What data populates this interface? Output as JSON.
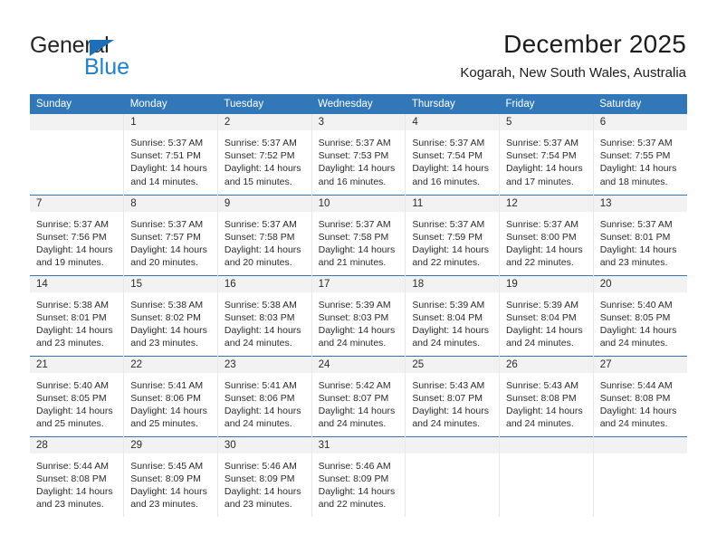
{
  "brand": {
    "word_one": "General",
    "word_two": "Blue",
    "triangle_color": "#1d6fb8",
    "blue_text_color": "#2081c9"
  },
  "header": {
    "title": "December 2025",
    "subtitle": "Kogarah, New South Wales, Australia",
    "header_bg_color": "#3278b8",
    "header_text_color": "#ffffff",
    "daynum_bg_color": "#f2f2f2"
  },
  "weekday_headers": [
    "Sunday",
    "Monday",
    "Tuesday",
    "Wednesday",
    "Thursday",
    "Friday",
    "Saturday"
  ],
  "weeks": [
    [
      {
        "day": "",
        "blank": true,
        "sunrise": "",
        "sunset": "",
        "daylight_1": "",
        "daylight_2": ""
      },
      {
        "day": "1",
        "sunrise": "Sunrise: 5:37 AM",
        "sunset": "Sunset: 7:51 PM",
        "daylight_1": "Daylight: 14 hours",
        "daylight_2": "and 14 minutes."
      },
      {
        "day": "2",
        "sunrise": "Sunrise: 5:37 AM",
        "sunset": "Sunset: 7:52 PM",
        "daylight_1": "Daylight: 14 hours",
        "daylight_2": "and 15 minutes."
      },
      {
        "day": "3",
        "sunrise": "Sunrise: 5:37 AM",
        "sunset": "Sunset: 7:53 PM",
        "daylight_1": "Daylight: 14 hours",
        "daylight_2": "and 16 minutes."
      },
      {
        "day": "4",
        "sunrise": "Sunrise: 5:37 AM",
        "sunset": "Sunset: 7:54 PM",
        "daylight_1": "Daylight: 14 hours",
        "daylight_2": "and 16 minutes."
      },
      {
        "day": "5",
        "sunrise": "Sunrise: 5:37 AM",
        "sunset": "Sunset: 7:54 PM",
        "daylight_1": "Daylight: 14 hours",
        "daylight_2": "and 17 minutes."
      },
      {
        "day": "6",
        "sunrise": "Sunrise: 5:37 AM",
        "sunset": "Sunset: 7:55 PM",
        "daylight_1": "Daylight: 14 hours",
        "daylight_2": "and 18 minutes."
      }
    ],
    [
      {
        "day": "7",
        "sunrise": "Sunrise: 5:37 AM",
        "sunset": "Sunset: 7:56 PM",
        "daylight_1": "Daylight: 14 hours",
        "daylight_2": "and 19 minutes."
      },
      {
        "day": "8",
        "sunrise": "Sunrise: 5:37 AM",
        "sunset": "Sunset: 7:57 PM",
        "daylight_1": "Daylight: 14 hours",
        "daylight_2": "and 20 minutes."
      },
      {
        "day": "9",
        "sunrise": "Sunrise: 5:37 AM",
        "sunset": "Sunset: 7:58 PM",
        "daylight_1": "Daylight: 14 hours",
        "daylight_2": "and 20 minutes."
      },
      {
        "day": "10",
        "sunrise": "Sunrise: 5:37 AM",
        "sunset": "Sunset: 7:58 PM",
        "daylight_1": "Daylight: 14 hours",
        "daylight_2": "and 21 minutes."
      },
      {
        "day": "11",
        "sunrise": "Sunrise: 5:37 AM",
        "sunset": "Sunset: 7:59 PM",
        "daylight_1": "Daylight: 14 hours",
        "daylight_2": "and 22 minutes."
      },
      {
        "day": "12",
        "sunrise": "Sunrise: 5:37 AM",
        "sunset": "Sunset: 8:00 PM",
        "daylight_1": "Daylight: 14 hours",
        "daylight_2": "and 22 minutes."
      },
      {
        "day": "13",
        "sunrise": "Sunrise: 5:37 AM",
        "sunset": "Sunset: 8:01 PM",
        "daylight_1": "Daylight: 14 hours",
        "daylight_2": "and 23 minutes."
      }
    ],
    [
      {
        "day": "14",
        "sunrise": "Sunrise: 5:38 AM",
        "sunset": "Sunset: 8:01 PM",
        "daylight_1": "Daylight: 14 hours",
        "daylight_2": "and 23 minutes."
      },
      {
        "day": "15",
        "sunrise": "Sunrise: 5:38 AM",
        "sunset": "Sunset: 8:02 PM",
        "daylight_1": "Daylight: 14 hours",
        "daylight_2": "and 23 minutes."
      },
      {
        "day": "16",
        "sunrise": "Sunrise: 5:38 AM",
        "sunset": "Sunset: 8:03 PM",
        "daylight_1": "Daylight: 14 hours",
        "daylight_2": "and 24 minutes."
      },
      {
        "day": "17",
        "sunrise": "Sunrise: 5:39 AM",
        "sunset": "Sunset: 8:03 PM",
        "daylight_1": "Daylight: 14 hours",
        "daylight_2": "and 24 minutes."
      },
      {
        "day": "18",
        "sunrise": "Sunrise: 5:39 AM",
        "sunset": "Sunset: 8:04 PM",
        "daylight_1": "Daylight: 14 hours",
        "daylight_2": "and 24 minutes."
      },
      {
        "day": "19",
        "sunrise": "Sunrise: 5:39 AM",
        "sunset": "Sunset: 8:04 PM",
        "daylight_1": "Daylight: 14 hours",
        "daylight_2": "and 24 minutes."
      },
      {
        "day": "20",
        "sunrise": "Sunrise: 5:40 AM",
        "sunset": "Sunset: 8:05 PM",
        "daylight_1": "Daylight: 14 hours",
        "daylight_2": "and 24 minutes."
      }
    ],
    [
      {
        "day": "21",
        "sunrise": "Sunrise: 5:40 AM",
        "sunset": "Sunset: 8:05 PM",
        "daylight_1": "Daylight: 14 hours",
        "daylight_2": "and 25 minutes."
      },
      {
        "day": "22",
        "sunrise": "Sunrise: 5:41 AM",
        "sunset": "Sunset: 8:06 PM",
        "daylight_1": "Daylight: 14 hours",
        "daylight_2": "and 25 minutes."
      },
      {
        "day": "23",
        "sunrise": "Sunrise: 5:41 AM",
        "sunset": "Sunset: 8:06 PM",
        "daylight_1": "Daylight: 14 hours",
        "daylight_2": "and 24 minutes."
      },
      {
        "day": "24",
        "sunrise": "Sunrise: 5:42 AM",
        "sunset": "Sunset: 8:07 PM",
        "daylight_1": "Daylight: 14 hours",
        "daylight_2": "and 24 minutes."
      },
      {
        "day": "25",
        "sunrise": "Sunrise: 5:43 AM",
        "sunset": "Sunset: 8:07 PM",
        "daylight_1": "Daylight: 14 hours",
        "daylight_2": "and 24 minutes."
      },
      {
        "day": "26",
        "sunrise": "Sunrise: 5:43 AM",
        "sunset": "Sunset: 8:08 PM",
        "daylight_1": "Daylight: 14 hours",
        "daylight_2": "and 24 minutes."
      },
      {
        "day": "27",
        "sunrise": "Sunrise: 5:44 AM",
        "sunset": "Sunset: 8:08 PM",
        "daylight_1": "Daylight: 14 hours",
        "daylight_2": "and 24 minutes."
      }
    ],
    [
      {
        "day": "28",
        "sunrise": "Sunrise: 5:44 AM",
        "sunset": "Sunset: 8:08 PM",
        "daylight_1": "Daylight: 14 hours",
        "daylight_2": "and 23 minutes."
      },
      {
        "day": "29",
        "sunrise": "Sunrise: 5:45 AM",
        "sunset": "Sunset: 8:09 PM",
        "daylight_1": "Daylight: 14 hours",
        "daylight_2": "and 23 minutes."
      },
      {
        "day": "30",
        "sunrise": "Sunrise: 5:46 AM",
        "sunset": "Sunset: 8:09 PM",
        "daylight_1": "Daylight: 14 hours",
        "daylight_2": "and 23 minutes."
      },
      {
        "day": "31",
        "sunrise": "Sunrise: 5:46 AM",
        "sunset": "Sunset: 8:09 PM",
        "daylight_1": "Daylight: 14 hours",
        "daylight_2": "and 22 minutes."
      },
      {
        "day": "",
        "blank": true,
        "sunrise": "",
        "sunset": "",
        "daylight_1": "",
        "daylight_2": ""
      },
      {
        "day": "",
        "blank": true,
        "sunrise": "",
        "sunset": "",
        "daylight_1": "",
        "daylight_2": ""
      },
      {
        "day": "",
        "blank": true,
        "sunrise": "",
        "sunset": "",
        "daylight_1": "",
        "daylight_2": ""
      }
    ]
  ]
}
